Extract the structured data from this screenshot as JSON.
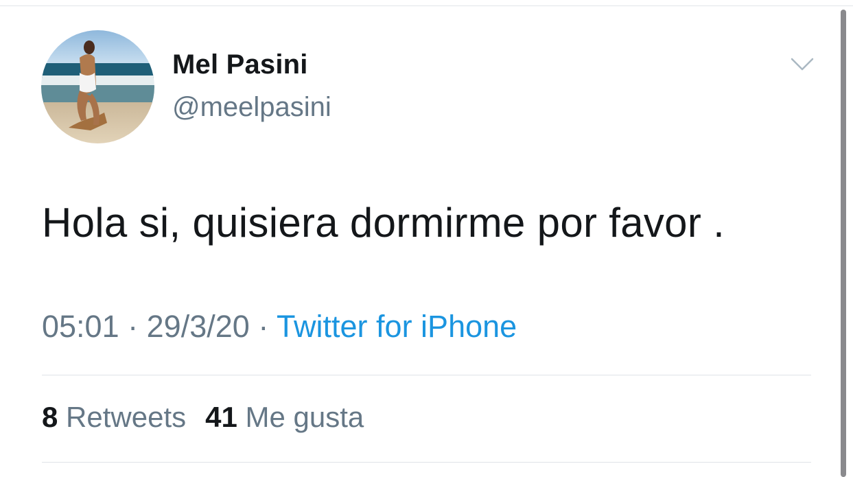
{
  "tweet": {
    "author": {
      "display_name": "Mel Pasini",
      "handle": "@meelpasini"
    },
    "text": "Hola si, quisiera dormirme por favor .",
    "time": "05:01",
    "date": "29/3/20",
    "separator": "·",
    "source": "Twitter for iPhone",
    "stats": {
      "retweets_count": "8",
      "retweets_label": "Retweets",
      "likes_count": "41",
      "likes_label": "Me gusta"
    }
  },
  "icons": {
    "more": "chevron-down-icon"
  },
  "colors": {
    "text_primary": "#14171a",
    "text_secondary": "#657786",
    "link": "#1b95e0",
    "divider": "#dfe3e7"
  }
}
